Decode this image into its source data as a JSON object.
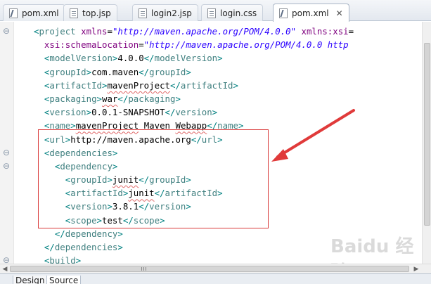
{
  "tabs": [
    {
      "label": "pom.xml",
      "icon": "xml-file-icon"
    },
    {
      "label": "top.jsp",
      "icon": "jsp-file-icon"
    },
    {
      "label": "login2.jsp",
      "icon": "jsp-file-icon"
    },
    {
      "label": "login.css",
      "icon": "css-file-icon"
    },
    {
      "label": "pom.xml",
      "icon": "xml-file-icon",
      "active": true
    }
  ],
  "editor": {
    "lines": [
      {
        "indent": "",
        "open": "project",
        "attrs": [
          {
            "name": "xmlns",
            "value": "\"http://maven.apache.org/POM/4.0.0\""
          },
          {
            "name": "xmlns:xsi",
            "value": ""
          }
        ]
      },
      {
        "indent": "  ",
        "attrs": [
          {
            "name": "xsi:schemaLocation",
            "value": "\"http://maven.apache.org/POM/4.0.0 http"
          }
        ]
      },
      {
        "indent": "  ",
        "open": "modelVersion",
        "text": "4.0.0",
        "close": "modelVersion"
      },
      {
        "indent": "  ",
        "open": "groupId",
        "text": "com.maven",
        "close": "groupId"
      },
      {
        "indent": "  ",
        "open": "artifactId",
        "text": "mavenProject",
        "close": "artifactId"
      },
      {
        "indent": "  ",
        "open": "packaging",
        "text": "war",
        "close": "packaging"
      },
      {
        "indent": "  ",
        "open": "version",
        "text": "0.0.1-SNAPSHOT",
        "close": "version"
      },
      {
        "indent": "  ",
        "open": "name",
        "text": "mavenProject Maven Webapp",
        "close": "name"
      },
      {
        "indent": "  ",
        "open": "url",
        "text": "http://maven.apache.org",
        "close": "url"
      },
      {
        "indent": "  ",
        "open": "dependencies"
      },
      {
        "indent": "    ",
        "open": "dependency"
      },
      {
        "indent": "      ",
        "open": "groupId",
        "text": "junit",
        "close": "groupId"
      },
      {
        "indent": "      ",
        "open": "artifactId",
        "text": "junit",
        "close": "artifactId"
      },
      {
        "indent": "      ",
        "open": "version",
        "text": "3.8.1",
        "close": "version"
      },
      {
        "indent": "      ",
        "open": "scope",
        "text": "test",
        "close": "scope"
      },
      {
        "indent": "    ",
        "close": "dependency"
      },
      {
        "indent": "  ",
        "close": "dependencies"
      },
      {
        "indent": "  ",
        "open": "build"
      }
    ],
    "fold_markers": [
      {
        "line": 0,
        "glyph": "⊖"
      },
      {
        "line": 9,
        "glyph": "⊖"
      },
      {
        "line": 10,
        "glyph": "⊖"
      },
      {
        "line": 17,
        "glyph": "⊖"
      }
    ],
    "highlight_color": "#d93a3a"
  },
  "bottom_tabs": [
    {
      "label": "Design"
    },
    {
      "label": "Source",
      "active": true
    }
  ],
  "watermark": "Baidu 经验"
}
